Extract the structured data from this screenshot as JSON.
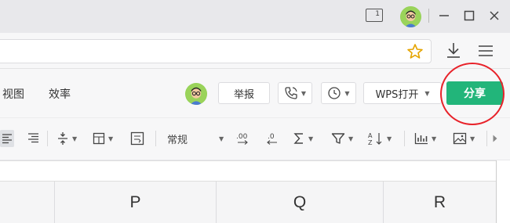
{
  "titlebar": {
    "window_count": "1",
    "icons": [
      "window-count-icon",
      "avatar-icon",
      "minimize-icon",
      "maximize-icon",
      "close-icon"
    ]
  },
  "address_bar": {
    "value": "",
    "icons": [
      "star-icon",
      "download-icon",
      "menu-icon"
    ]
  },
  "ribbon": {
    "tabs": [
      {
        "label": "视图"
      },
      {
        "label": "效率"
      }
    ],
    "report_label": "举报",
    "wps_open_label": "WPS打开",
    "share_label": "分享"
  },
  "toolbar": {
    "number_format": "常规"
  },
  "sheet": {
    "columns": [
      "P",
      "Q",
      "R"
    ]
  },
  "colors": {
    "share_green": "#22b57a",
    "annotation_red": "#e8222a"
  }
}
